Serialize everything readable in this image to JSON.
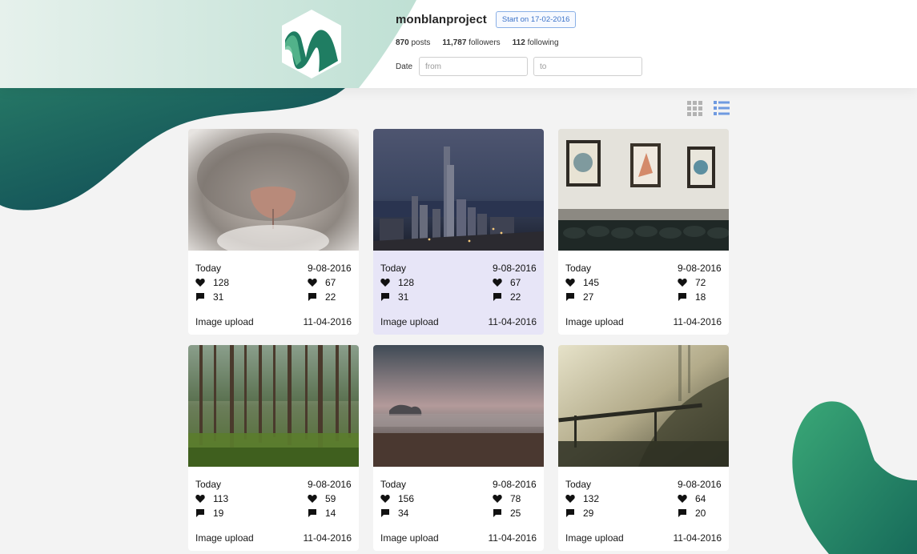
{
  "profile": {
    "username": "monblanproject",
    "start_badge": "Start on 17-02-2016",
    "posts_count": "870",
    "posts_label": "posts",
    "followers_count": "11,787",
    "followers_label": "followers",
    "following_count": "112",
    "following_label": "following"
  },
  "filter": {
    "date_label": "Date",
    "from_placeholder": "from",
    "to_placeholder": "to"
  },
  "view": {
    "active": "list"
  },
  "colors": {
    "accent": "#3b72c8",
    "brand_green": "#2e7d63",
    "selected_card": "#e7e5f7"
  },
  "posts": [
    {
      "day": "Today",
      "date": "9-08-2016",
      "likes": "128",
      "likes_right": "67",
      "comments": "31",
      "comments_right": "22",
      "type": "Image upload",
      "upload_date": "11-04-2016",
      "photo": "cat-nose"
    },
    {
      "day": "Today",
      "date": "9-08-2016",
      "likes": "128",
      "likes_right": "67",
      "comments": "31",
      "comments_right": "22",
      "type": "Image upload",
      "upload_date": "11-04-2016",
      "photo": "city-skyline",
      "selected": true
    },
    {
      "day": "Today",
      "date": "9-08-2016",
      "likes": "145",
      "likes_right": "72",
      "comments": "27",
      "comments_right": "18",
      "type": "Image upload",
      "upload_date": "11-04-2016",
      "photo": "framed-pictures"
    },
    {
      "day": "Today",
      "date": "9-08-2016",
      "likes": "113",
      "likes_right": "59",
      "comments": "19",
      "comments_right": "14",
      "type": "Image upload",
      "upload_date": "11-04-2016",
      "photo": "pine-forest"
    },
    {
      "day": "Today",
      "date": "9-08-2016",
      "likes": "156",
      "likes_right": "78",
      "comments": "34",
      "comments_right": "25",
      "type": "Image upload",
      "upload_date": "11-04-2016",
      "photo": "misty-field"
    },
    {
      "day": "Today",
      "date": "9-08-2016",
      "likes": "132",
      "likes_right": "64",
      "comments": "29",
      "comments_right": "20",
      "type": "Image upload",
      "upload_date": "11-04-2016",
      "photo": "foggy-bridge"
    }
  ]
}
